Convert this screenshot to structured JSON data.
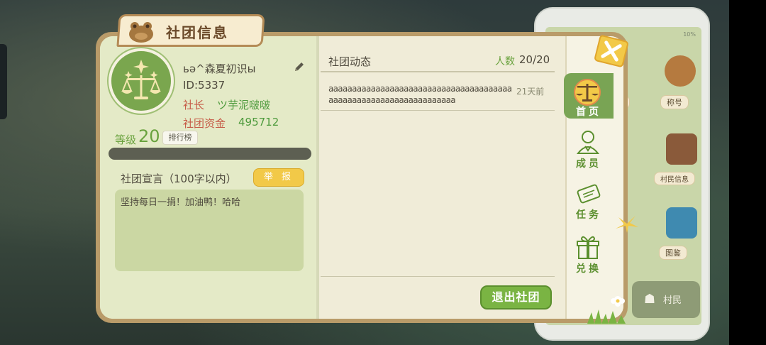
{
  "window": {
    "title": "社团信息"
  },
  "phone": {
    "status": "10%",
    "labels": {
      "title_btn": "称号",
      "villager_info": "村民信息",
      "atlas": "图鉴",
      "villager": "村民"
    }
  },
  "club": {
    "name": "ьә^森夏初识ы",
    "id": "ID:5337",
    "leader_label": "社长",
    "leader_name": "ツ芋泥啵啵",
    "funds_label": "社团资金",
    "funds_value": "495712",
    "level_label": "等级",
    "level_value": "20",
    "level_progress": 0,
    "rank_button": "排行榜",
    "declaration_label": "社团宣言（100字以内）",
    "report_button": "举 报",
    "declaration_text": "坚持每日一捐！加油鸭！哈哈"
  },
  "news": {
    "title": "社团动态",
    "members_label": "人数",
    "members_value": "20/20",
    "items": [
      {
        "text": "aaaaaaaaaaaaaaaaaaaaaaaaaaaaaaaaaaaaaaaaaaaaaaaaaaaaaaaaaaaaaaaaaa",
        "time": "21天前"
      }
    ]
  },
  "buttons": {
    "leave": "退出社团"
  },
  "nav": [
    {
      "label": "首页",
      "icon": "scales-icon",
      "active": true
    },
    {
      "label": "成员",
      "icon": "member-icon",
      "active": false
    },
    {
      "label": "任务",
      "icon": "scroll-icon",
      "active": false
    },
    {
      "label": "兑换",
      "icon": "gift-icon",
      "active": false
    }
  ],
  "colors": {
    "accent_green": "#7ab443",
    "panel_border": "#b99b69",
    "report_yellow": "#f2c948",
    "leader_red": "#c65b47"
  }
}
